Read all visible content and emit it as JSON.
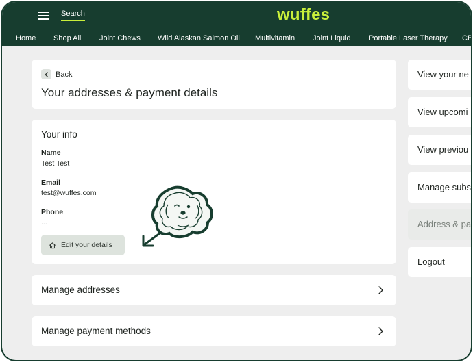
{
  "header": {
    "search_label": "Search",
    "logo_text": "wuffes",
    "colors": {
      "brand_green": "#173d2f",
      "accent_lime": "#c9ef3b"
    }
  },
  "nav": {
    "items": [
      "Home",
      "Shop All",
      "Joint Chews",
      "Wild Alaskan Salmon Oil",
      "Multivitamin",
      "Joint Liquid",
      "Portable Laser Therapy",
      "CB"
    ]
  },
  "title_card": {
    "back_label": "Back",
    "title": "Your addresses & payment details"
  },
  "info_card": {
    "title": "Your info",
    "name_label": "Name",
    "name_value": "Test Test",
    "email_label": "Email",
    "email_value": "test@wuffes.com",
    "phone_label": "Phone",
    "phone_value": "...",
    "edit_label": "Edit your details"
  },
  "rows": {
    "addresses": "Manage addresses",
    "payments": "Manage payment methods"
  },
  "sidebar": {
    "items": [
      {
        "label": "View your ne"
      },
      {
        "label": "View upcomi"
      },
      {
        "label": "View previou"
      },
      {
        "label": "Manage subs"
      },
      {
        "label": "Address & pa",
        "active": true
      },
      {
        "label": "Logout"
      }
    ]
  }
}
